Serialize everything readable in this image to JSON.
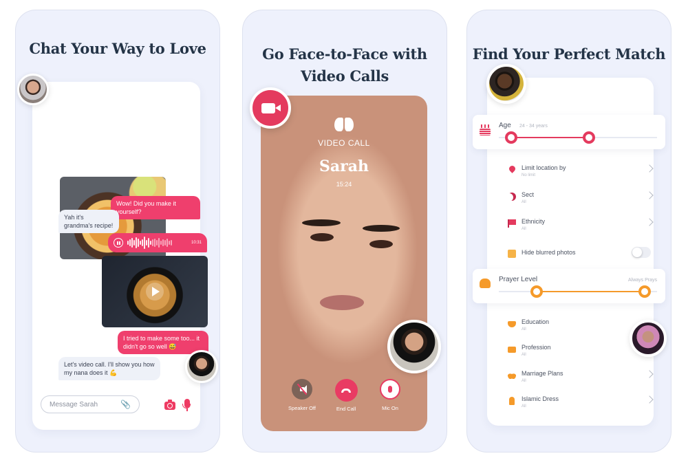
{
  "panels": {
    "chat": {
      "title": "Chat Your Way to Love",
      "messages": [
        {
          "from": "me",
          "text": "Wow! Did you make it yourself?"
        },
        {
          "from": "them",
          "text": "Yah it's grandma's recipe!"
        },
        {
          "from": "me",
          "type": "voice",
          "duration": "10:31"
        },
        {
          "from": "me",
          "text": "I tried to make some too... it didn't go so well 😅"
        },
        {
          "from": "them",
          "text": "Let's video call. I'll show you how my nana does it 💪"
        }
      ],
      "input_placeholder": "Message Sarah"
    },
    "video": {
      "title_line1": "Go Face-to-Face with",
      "title_line2": "Video Calls",
      "call_label": "VIDEO CALL",
      "caller_name": "Sarah",
      "call_time": "15:24",
      "controls": [
        {
          "label": "Speaker Off"
        },
        {
          "label": "End Call"
        },
        {
          "label": "Mic On"
        }
      ]
    },
    "match": {
      "title": "Find Your Perfect Match",
      "age": {
        "label": "Age",
        "range_text": "24 - 34 years",
        "low_fraction": 0.08,
        "high_fraction": 0.57
      },
      "filters_top": [
        {
          "title": "Limit location by",
          "value": "No limit"
        },
        {
          "title": "Sect",
          "value": "All"
        },
        {
          "title": "Ethnicity",
          "value": "All"
        }
      ],
      "hide_blurred": {
        "label": "Hide blurred photos",
        "enabled": false
      },
      "prayer": {
        "label": "Prayer Level",
        "range_text": "Always Prays",
        "low_fraction": 0.24,
        "high_fraction": 0.92
      },
      "filters_bottom": [
        {
          "title": "Education",
          "value": "All"
        },
        {
          "title": "Profession",
          "value": "All"
        },
        {
          "title": "Marriage Plans",
          "value": "All"
        },
        {
          "title": "Islamic Dress",
          "value": "All"
        }
      ]
    }
  },
  "colors": {
    "accent_pink": "#e43a5e",
    "accent_orange": "#f59a2a",
    "panel_bg": "#eef1fc",
    "title": "#243447"
  }
}
